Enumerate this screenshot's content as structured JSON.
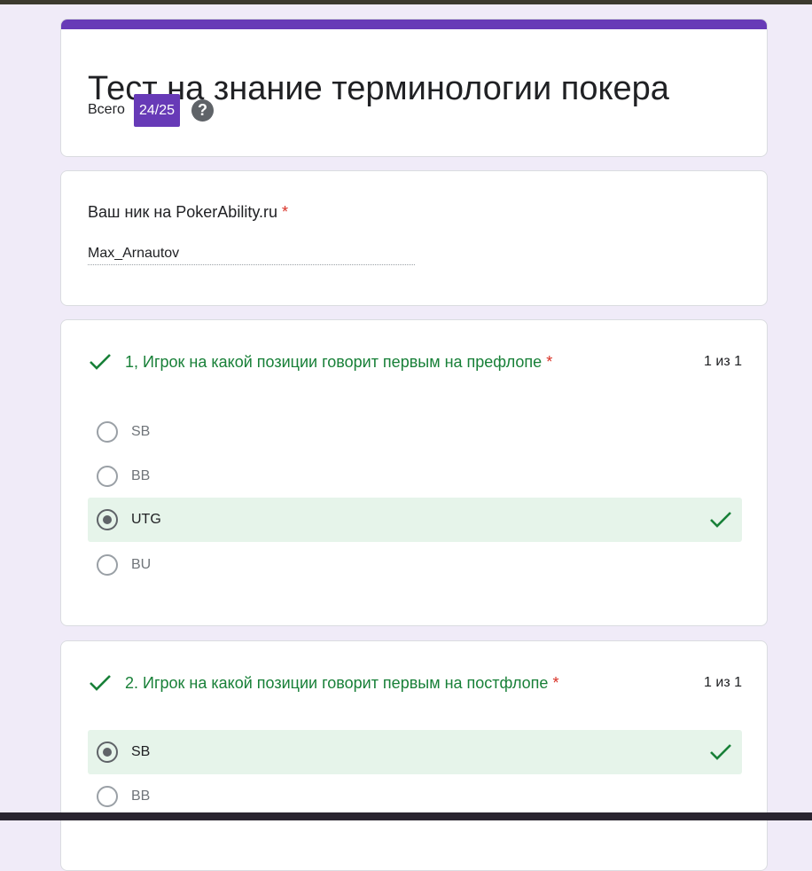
{
  "form": {
    "title": "Тест на знание терминологии покера",
    "score_label": "Всего",
    "score_value": "24/25",
    "help_icon": "?"
  },
  "nick": {
    "label": "Ваш ник на PokerAbility.ru",
    "required_mark": "*",
    "value": "Max_Arnautov"
  },
  "questions": [
    {
      "title": "1, Игрок на какой позиции говорит первым на префлопе",
      "required_mark": "*",
      "points": "1 из 1",
      "status": "correct",
      "options": [
        {
          "label": "SB",
          "selected": false,
          "correct": false
        },
        {
          "label": "BB",
          "selected": false,
          "correct": false
        },
        {
          "label": "UTG",
          "selected": true,
          "correct": true
        },
        {
          "label": "BU",
          "selected": false,
          "correct": false
        }
      ]
    },
    {
      "title": "2. Игрок на какой позиции говорит первым на постфлопе",
      "required_mark": "*",
      "points": "1 из 1",
      "status": "correct",
      "options": [
        {
          "label": "SB",
          "selected": true,
          "correct": true
        },
        {
          "label": "BB",
          "selected": false,
          "correct": false
        }
      ]
    }
  ],
  "colors": {
    "accent": "#673ab7",
    "correct": "#188038",
    "correct_bg": "#e6f4ea",
    "required": "#d93025",
    "background": "#f0ebf8"
  },
  "icons": {
    "question_status": "checkmark-icon",
    "option_correct": "checkmark-icon",
    "help": "help-circle-icon"
  }
}
